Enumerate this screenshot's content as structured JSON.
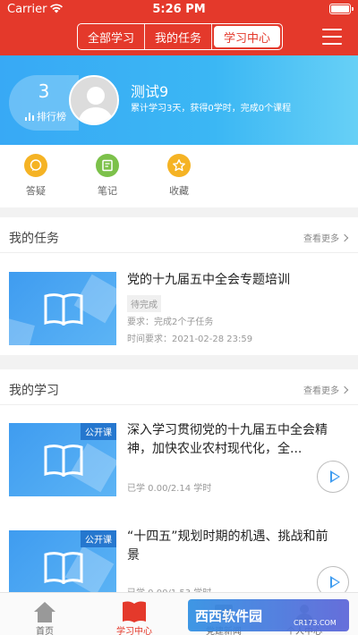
{
  "status": {
    "carrier": "Carrier",
    "time": "5:26 PM"
  },
  "header": {
    "tabs": [
      {
        "label": "全部学习",
        "active": false
      },
      {
        "label": "我的任务",
        "active": false
      },
      {
        "label": "学习中心",
        "active": true
      }
    ]
  },
  "profile": {
    "rank": "3",
    "rank_label": "排行榜",
    "name": "测试9",
    "summary": "累计学习3天，获得0学时，完成0个课程"
  },
  "quick": [
    {
      "label": "答疑",
      "icon": "qa-icon",
      "color": "#f5b324"
    },
    {
      "label": "笔记",
      "icon": "notes-icon",
      "color": "#7cc14a"
    },
    {
      "label": "收藏",
      "icon": "star-icon",
      "color": "#f5b324"
    }
  ],
  "tasks": {
    "title": "我的任务",
    "more": "查看更多",
    "items": [
      {
        "title": "党的十九届五中全会专题培训",
        "status": "待完成",
        "requirement": "要求：完成2个子任务",
        "deadline": "时间要求：2021-02-28 23:59"
      }
    ]
  },
  "learning": {
    "title": "我的学习",
    "more": "查看更多",
    "items": [
      {
        "badge": "公开课",
        "title": "深入学习贯彻党的十九届五中全会精神，加快农业农村现代化，全...",
        "progress": "已学 0.00/2.14 学时"
      },
      {
        "badge": "公开课",
        "title": "“十四五”规划时期的机遇、挑战和前景",
        "progress": "已学 0.00/1.53 学时"
      }
    ]
  },
  "tabbar": [
    {
      "label": "首页",
      "active": false
    },
    {
      "label": "学习中心",
      "active": true
    },
    {
      "label": "党建新闻",
      "active": false
    },
    {
      "label": "个人中心",
      "active": false
    }
  ],
  "watermark": {
    "text": "西西软件园",
    "sub": "CR173.COM"
  }
}
